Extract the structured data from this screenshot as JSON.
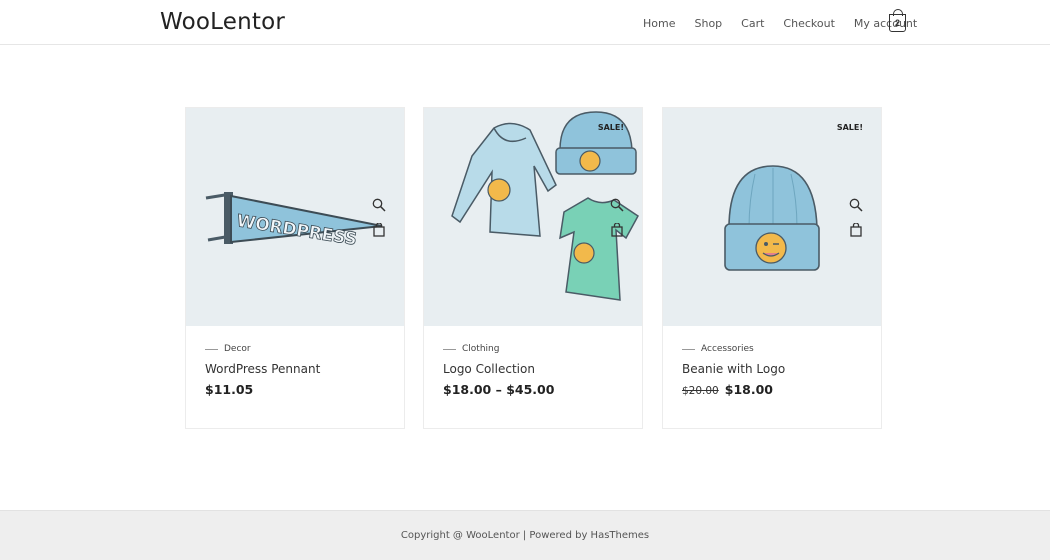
{
  "header": {
    "logo": "WooLentor",
    "nav": [
      "Home",
      "Shop",
      "Cart",
      "Checkout",
      "My account"
    ],
    "cart_count": "2"
  },
  "products": [
    {
      "category": "Decor",
      "title": "WordPress Pennant",
      "price": "$11.05",
      "old_price": "",
      "sale": "",
      "image": "pennant"
    },
    {
      "category": "Clothing",
      "title": "Logo Collection",
      "price": "$18.00 – $45.00",
      "old_price": "",
      "sale": "SALE!",
      "image": "logo-collection"
    },
    {
      "category": "Accessories",
      "title": "Beanie with Logo",
      "price": "$18.00",
      "old_price": "$20.00",
      "sale": "SALE!",
      "image": "beanie"
    }
  ],
  "pennant_text": "WORDPRESS",
  "footer": {
    "text": "Copyright @ WooLentor | Powered by HasThemes"
  },
  "colors": {
    "image_bg": "#e8eef1",
    "item_blue": "#8fc3db",
    "item_green": "#79d1b6",
    "footer_bg": "#eeeeee"
  },
  "icons": [
    "cart-icon",
    "zoom-icon",
    "bag-icon"
  ]
}
